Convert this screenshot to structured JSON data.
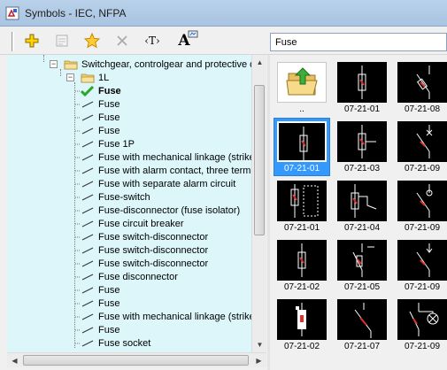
{
  "window": {
    "title": "Symbols - IEC, NFPA"
  },
  "toolbar": {
    "buttons": [
      {
        "name": "new-symbol-button",
        "icon": "plus-icon"
      },
      {
        "name": "properties-button",
        "icon": "properties-icon"
      },
      {
        "name": "favorite-button",
        "icon": "star-icon"
      },
      {
        "name": "delete-button",
        "icon": "delete-icon"
      },
      {
        "name": "text-tag-button",
        "icon": "text-tag-icon",
        "text": "‹T›"
      },
      {
        "name": "font-button",
        "icon": "font-icon",
        "text": "A"
      }
    ],
    "search_value": "Fuse"
  },
  "tree": {
    "category_label": "Switchgear, controlgear and protective de",
    "folder_label": "1L",
    "items": [
      {
        "label": "Fuse",
        "bold": true,
        "checked": true
      },
      {
        "label": "Fuse"
      },
      {
        "label": "Fuse"
      },
      {
        "label": "Fuse"
      },
      {
        "label": "Fuse 1P"
      },
      {
        "label": "Fuse with mechanical linkage (strike"
      },
      {
        "label": "Fuse with alarm contact, three term"
      },
      {
        "label": "Fuse with separate alarm circuit"
      },
      {
        "label": "Fuse-switch"
      },
      {
        "label": "Fuse-disconnector (fuse isolator)"
      },
      {
        "label": "Fuse circuit breaker"
      },
      {
        "label": "Fuse switch-disconnector"
      },
      {
        "label": "Fuse switch-disconnector"
      },
      {
        "label": "Fuse switch-disconnector"
      },
      {
        "label": "Fuse disconnector"
      },
      {
        "label": "Fuse"
      },
      {
        "label": "Fuse"
      },
      {
        "label": "Fuse with mechanical linkage (strike"
      },
      {
        "label": "Fuse"
      },
      {
        "label": "Fuse socket"
      }
    ]
  },
  "thumbnails": [
    {
      "caption": "..",
      "kind": "folder"
    },
    {
      "caption": "07-21-01",
      "kind": "fuse-straight"
    },
    {
      "caption": "07-21-08",
      "kind": "fuse-diagonal"
    },
    {
      "caption": "07-21-01",
      "kind": "fuse-straight",
      "selected": true
    },
    {
      "caption": "07-21-03",
      "kind": "fuse-tap"
    },
    {
      "caption": "07-21-09",
      "kind": "fuse-diagonal-x"
    },
    {
      "caption": "07-21-01",
      "kind": "fuse-box"
    },
    {
      "caption": "07-21-04",
      "kind": "fuse-switch"
    },
    {
      "caption": "07-21-09",
      "kind": "fuse-diagonal-circle"
    },
    {
      "caption": "07-21-02",
      "kind": "fuse-straight"
    },
    {
      "caption": "07-21-05",
      "kind": "fuse-break"
    },
    {
      "caption": "07-21-09",
      "kind": "fuse-diagonal-v"
    },
    {
      "caption": "07-21-02",
      "kind": "fuse-box-red"
    },
    {
      "caption": "07-21-07",
      "kind": "fuse-diagonal-long"
    },
    {
      "caption": "07-21-09",
      "kind": "fuse-alarm"
    }
  ],
  "colors": {
    "tree_background": "#dcf6fa",
    "selection": "#3399ff",
    "check": "#2aa52a",
    "symbol_red": "#e03030"
  }
}
